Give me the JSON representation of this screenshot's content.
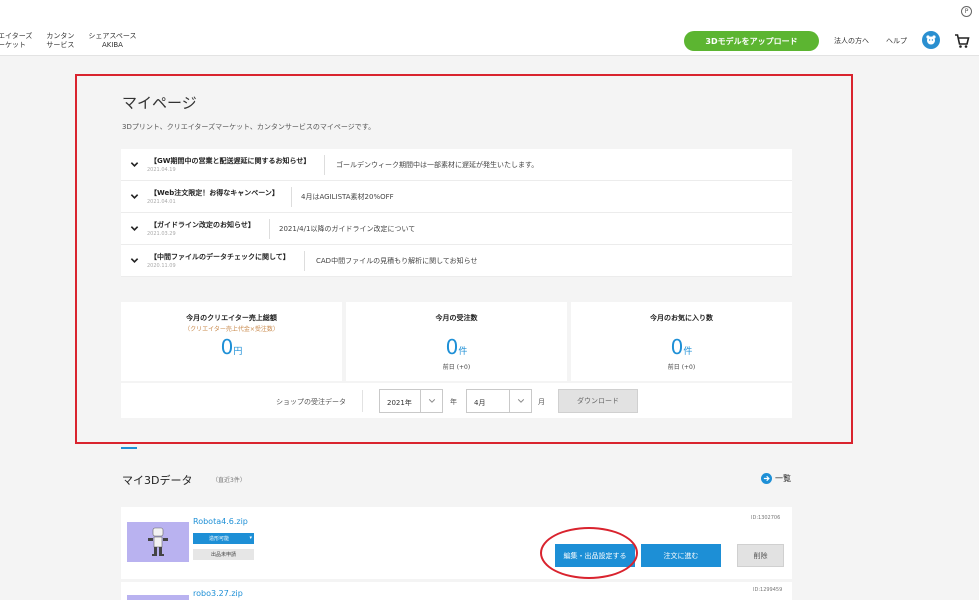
{
  "header": {
    "nav": [
      {
        "line1": "エイターズ",
        "line2": "ーケット"
      },
      {
        "line1": "カンタン",
        "line2": "サービス"
      },
      {
        "line1": "シェアスペース",
        "line2": "AKIBA"
      }
    ],
    "upload_label": "3Dモデルをアップロード",
    "corp_label": "法人の方へ",
    "help_label": "ヘルプ",
    "p_badge": "P"
  },
  "mypage": {
    "title": "マイページ",
    "description": "3Dプリント、クリエイターズマーケット、カンタンサービスのマイページです。",
    "news": [
      {
        "title": "【GW期間中の営業と配送遅延に関するお知らせ】",
        "date": "2021.04.19",
        "desc": "ゴールデンウィーク期間中は一部素材に遅延が発生いたします。"
      },
      {
        "title": "【Web注文限定！お得なキャンペーン】",
        "date": "2021.04.01",
        "desc": "4月はAGILISTA素材20%OFF"
      },
      {
        "title": "【ガイドライン改定のお知らせ】",
        "date": "2021.03.29",
        "desc": "2021/4/1以降のガイドライン改定について"
      },
      {
        "title": "【中間ファイルのデータチェックに関して】",
        "date": "2020.11.09",
        "desc": "CAD中間ファイルの見積もり解析に関してお知らせ"
      }
    ],
    "stats": [
      {
        "label": "今月のクリエイター売上総額",
        "sub": "（クリエイター売上代金×受注数）",
        "value": "0",
        "unit": "円",
        "prev": ""
      },
      {
        "label": "今月の受注数",
        "sub": "",
        "value": "0",
        "unit": "件",
        "prev": "前日 (+0)"
      },
      {
        "label": "今月のお気に入り数",
        "sub": "",
        "value": "0",
        "unit": "件",
        "prev": "前日 (+0)"
      }
    ],
    "shop": {
      "label": "ショップの受注データ",
      "year_value": "2021年",
      "year_unit": "年",
      "month_value": "4月",
      "month_unit": "月",
      "download_label": "ダウンロード"
    }
  },
  "my3d": {
    "title": "マイ3Dデータ",
    "subtitle": "（直近3件）",
    "list_link": "一覧",
    "items": [
      {
        "name": "Robota4.6.zip",
        "id": "ID:1302706",
        "status_print": "造形可能",
        "status_sale": "出品未申請",
        "edit_label": "編集・出品設定する",
        "order_label": "注文に進む",
        "delete_label": "削除"
      },
      {
        "name": "robo3.27.zip",
        "id": "ID:1299459"
      }
    ]
  },
  "colors": {
    "accent": "#1d8fd6",
    "upload": "#5cb531",
    "highlight": "#d9232e"
  }
}
